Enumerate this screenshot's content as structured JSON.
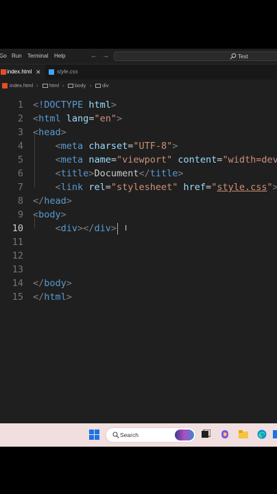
{
  "menubar": {
    "items": [
      "Go",
      "Run",
      "Terminal",
      "Help"
    ],
    "nav_back": "←",
    "nav_forward": "→",
    "search_text": "Test"
  },
  "tabs": [
    {
      "label": "index.html",
      "close": "✕",
      "active": true,
      "icon": "html-file-icon"
    },
    {
      "label": "style.css",
      "active": false,
      "icon": "css-file-icon"
    }
  ],
  "breadcrumb": [
    "index.html",
    "html",
    "body",
    "div"
  ],
  "editor": {
    "current_line": 10,
    "lines": [
      {
        "n": "1",
        "tokens": [
          [
            "br",
            "<"
          ],
          [
            "tag",
            "!DOCTYPE"
          ],
          [
            "txt",
            " "
          ],
          [
            "attr",
            "html"
          ],
          [
            "br",
            ">"
          ]
        ]
      },
      {
        "n": "2",
        "tokens": [
          [
            "br",
            "<"
          ],
          [
            "tag",
            "html"
          ],
          [
            "txt",
            " "
          ],
          [
            "attr",
            "lang"
          ],
          [
            "txt",
            "="
          ],
          [
            "str",
            "\"en\""
          ],
          [
            "br",
            ">"
          ]
        ]
      },
      {
        "n": "3",
        "tokens": [
          [
            "br",
            "<"
          ],
          [
            "tag",
            "head"
          ],
          [
            "br",
            ">"
          ]
        ]
      },
      {
        "n": "4",
        "tokens": [
          [
            "txt",
            "    "
          ],
          [
            "br",
            "<"
          ],
          [
            "tag",
            "meta"
          ],
          [
            "txt",
            " "
          ],
          [
            "attr",
            "charset"
          ],
          [
            "txt",
            "="
          ],
          [
            "str",
            "\"UTF-8\""
          ],
          [
            "br",
            ">"
          ]
        ]
      },
      {
        "n": "5",
        "tokens": [
          [
            "txt",
            "    "
          ],
          [
            "br",
            "<"
          ],
          [
            "tag",
            "meta"
          ],
          [
            "txt",
            " "
          ],
          [
            "attr",
            "name"
          ],
          [
            "txt",
            "="
          ],
          [
            "str",
            "\"viewport\""
          ],
          [
            "txt",
            " "
          ],
          [
            "attr",
            "content"
          ],
          [
            "txt",
            "="
          ],
          [
            "str",
            "\"width=device"
          ]
        ]
      },
      {
        "n": "6",
        "tokens": [
          [
            "txt",
            "    "
          ],
          [
            "br",
            "<"
          ],
          [
            "tag",
            "title"
          ],
          [
            "br",
            ">"
          ],
          [
            "txt",
            "Document"
          ],
          [
            "br",
            "</"
          ],
          [
            "tag",
            "title"
          ],
          [
            "br",
            ">"
          ]
        ]
      },
      {
        "n": "7",
        "tokens": [
          [
            "txt",
            "    "
          ],
          [
            "br",
            "<"
          ],
          [
            "tag",
            "link"
          ],
          [
            "txt",
            " "
          ],
          [
            "attr",
            "rel"
          ],
          [
            "txt",
            "="
          ],
          [
            "str",
            "\"stylesheet\""
          ],
          [
            "txt",
            " "
          ],
          [
            "attr",
            "href"
          ],
          [
            "txt",
            "="
          ],
          [
            "str",
            "\""
          ],
          [
            "link",
            "style.css"
          ],
          [
            "str",
            "\""
          ],
          [
            "br",
            ">"
          ]
        ]
      },
      {
        "n": "8",
        "tokens": [
          [
            "br",
            "</"
          ],
          [
            "tag",
            "head"
          ],
          [
            "br",
            ">"
          ]
        ]
      },
      {
        "n": "9",
        "tokens": [
          [
            "br",
            "<"
          ],
          [
            "tag",
            "body"
          ],
          [
            "br",
            ">"
          ]
        ]
      },
      {
        "n": "10",
        "tokens": [
          [
            "txt",
            "    "
          ],
          [
            "br",
            "<"
          ],
          [
            "tag",
            "div"
          ],
          [
            "br",
            "></"
          ],
          [
            "tag",
            "div"
          ],
          [
            "br",
            ">"
          ]
        ]
      },
      {
        "n": "11",
        "tokens": []
      },
      {
        "n": "12",
        "tokens": []
      },
      {
        "n": "13",
        "tokens": []
      },
      {
        "n": "14",
        "tokens": [
          [
            "br",
            "</"
          ],
          [
            "tag",
            "body"
          ],
          [
            "br",
            ">"
          ]
        ]
      },
      {
        "n": "15",
        "tokens": [
          [
            "br",
            "</"
          ],
          [
            "tag",
            "html"
          ],
          [
            "br",
            ">"
          ]
        ]
      }
    ]
  },
  "taskbar": {
    "search_label": "Search",
    "icons": [
      "windows-start-icon",
      "copilot-icon",
      "file-explorer-icon",
      "edge-icon"
    ]
  },
  "colors": {
    "editor_bg": "#1f1f1f",
    "tag": "#569cd6",
    "attribute": "#9cdcfe",
    "string": "#ce9178",
    "bracket": "#808080",
    "taskbar_bg": "#f1dede"
  }
}
